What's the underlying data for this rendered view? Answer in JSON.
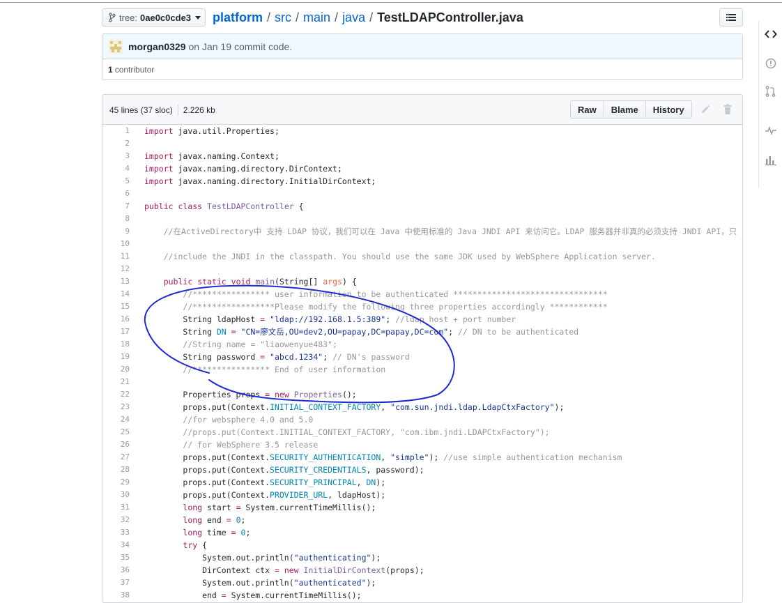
{
  "branch": {
    "prefix": "tree:",
    "name": "0ae0c0cde3"
  },
  "breadcrumb": {
    "repo": "platform",
    "segments": [
      "src",
      "main",
      "java"
    ],
    "separator": "/",
    "file": "TestLDAPController.java"
  },
  "commit": {
    "author": "morgan0329",
    "date": "on Jan 19",
    "message": "commit code.",
    "contributors_count": "1",
    "contributors_label": "contributor"
  },
  "file": {
    "lines_info": "45 lines (37 sloc)",
    "size": "2.226 kb",
    "buttons": {
      "raw": "Raw",
      "blame": "Blame",
      "history": "History"
    }
  },
  "code_lines": [
    {
      "n": "1",
      "t": [
        {
          "c": "kw",
          "v": "import"
        },
        {
          "c": "",
          "v": " java.util.Properties;"
        }
      ]
    },
    {
      "n": "2",
      "t": []
    },
    {
      "n": "3",
      "t": [
        {
          "c": "kw",
          "v": "import"
        },
        {
          "c": "",
          "v": " javax.naming.Context;"
        }
      ]
    },
    {
      "n": "4",
      "t": [
        {
          "c": "kw",
          "v": "import"
        },
        {
          "c": "",
          "v": " javax.naming.directory.DirContext;"
        }
      ]
    },
    {
      "n": "5",
      "t": [
        {
          "c": "kw",
          "v": "import"
        },
        {
          "c": "",
          "v": " javax.naming.directory.InitialDirContext;"
        }
      ]
    },
    {
      "n": "6",
      "t": []
    },
    {
      "n": "7",
      "t": [
        {
          "c": "kw",
          "v": "public"
        },
        {
          "c": "",
          "v": " "
        },
        {
          "c": "kw",
          "v": "class"
        },
        {
          "c": "",
          "v": " "
        },
        {
          "c": "en",
          "v": "TestLDAPController"
        },
        {
          "c": "",
          "v": " {"
        }
      ]
    },
    {
      "n": "8",
      "t": []
    },
    {
      "n": "9",
      "t": [
        {
          "c": "",
          "v": "    "
        },
        {
          "c": "c",
          "v": "//在ActiveDirectory中 支持 LDAP 协议，我们可以在 Java 中使用标准的 Java JNDI API 来访问它。LDAP 服务器并非真的必须支持 JNDI API，只要"
        }
      ]
    },
    {
      "n": "10",
      "t": []
    },
    {
      "n": "11",
      "t": [
        {
          "c": "",
          "v": "    "
        },
        {
          "c": "c",
          "v": "//include the JNDI in the classpath. You should use the same JDK used by WebSphere Application server."
        }
      ]
    },
    {
      "n": "12",
      "t": []
    },
    {
      "n": "13",
      "t": [
        {
          "c": "",
          "v": "    "
        },
        {
          "c": "kw",
          "v": "public"
        },
        {
          "c": "",
          "v": " "
        },
        {
          "c": "kw",
          "v": "static"
        },
        {
          "c": "",
          "v": " "
        },
        {
          "c": "kw",
          "v": "void"
        },
        {
          "c": "",
          "v": " "
        },
        {
          "c": "en",
          "v": "main"
        },
        {
          "c": "",
          "v": "(String[] "
        },
        {
          "c": "v",
          "v": "args"
        },
        {
          "c": "",
          "v": ") {"
        }
      ]
    },
    {
      "n": "14",
      "t": [
        {
          "c": "",
          "v": "        "
        },
        {
          "c": "c",
          "v": "//**************** user information to be authenticated ********************************"
        }
      ]
    },
    {
      "n": "15",
      "t": [
        {
          "c": "",
          "v": "        "
        },
        {
          "c": "c",
          "v": "//*****************Please modify the following three properties accordingly ************"
        }
      ]
    },
    {
      "n": "16",
      "t": [
        {
          "c": "",
          "v": "        String ldapHost "
        },
        {
          "c": "kw",
          "v": "="
        },
        {
          "c": "",
          "v": " "
        },
        {
          "c": "s",
          "v": "\"ldap://192.168.1.5:389\""
        },
        {
          "c": "",
          "v": "; "
        },
        {
          "c": "c",
          "v": "//ldap host + port number"
        }
      ]
    },
    {
      "n": "17",
      "t": [
        {
          "c": "",
          "v": "        String "
        },
        {
          "c": "cn",
          "v": "DN"
        },
        {
          "c": "",
          "v": " "
        },
        {
          "c": "kw",
          "v": "="
        },
        {
          "c": "",
          "v": " "
        },
        {
          "c": "s",
          "v": "\"CN=廖文岳,OU=dev2,OU=papay,DC=papay,DC=com\""
        },
        {
          "c": "",
          "v": "; "
        },
        {
          "c": "c",
          "v": "// DN to be authenticated"
        }
      ]
    },
    {
      "n": "18",
      "t": [
        {
          "c": "",
          "v": "        "
        },
        {
          "c": "c",
          "v": "//String name = \"liaowenyue483\";"
        }
      ]
    },
    {
      "n": "19",
      "t": [
        {
          "c": "",
          "v": "        String password "
        },
        {
          "c": "kw",
          "v": "="
        },
        {
          "c": "",
          "v": " "
        },
        {
          "c": "s",
          "v": "\"abcd.1234\""
        },
        {
          "c": "",
          "v": "; "
        },
        {
          "c": "c",
          "v": "// DN's password"
        }
      ]
    },
    {
      "n": "20",
      "t": [
        {
          "c": "",
          "v": "        "
        },
        {
          "c": "c",
          "v": "//**************** End of user information"
        }
      ]
    },
    {
      "n": "21",
      "t": []
    },
    {
      "n": "22",
      "t": [
        {
          "c": "",
          "v": "        Properties props "
        },
        {
          "c": "kw",
          "v": "="
        },
        {
          "c": "",
          "v": " "
        },
        {
          "c": "kw",
          "v": "new"
        },
        {
          "c": "",
          "v": " "
        },
        {
          "c": "en",
          "v": "Properties"
        },
        {
          "c": "",
          "v": "();"
        }
      ]
    },
    {
      "n": "23",
      "t": [
        {
          "c": "",
          "v": "        props.put(Context."
        },
        {
          "c": "cn",
          "v": "INITIAL_CONTEXT_FACTORY"
        },
        {
          "c": "",
          "v": ", "
        },
        {
          "c": "s",
          "v": "\"com.sun.jndi.ldap.LdapCtxFactory\""
        },
        {
          "c": "",
          "v": ");"
        }
      ]
    },
    {
      "n": "24",
      "t": [
        {
          "c": "",
          "v": "        "
        },
        {
          "c": "c",
          "v": "//for websphere 4.0 and 5.0"
        }
      ]
    },
    {
      "n": "25",
      "t": [
        {
          "c": "",
          "v": "        "
        },
        {
          "c": "c",
          "v": "//props.put(Context.INITIAL_CONTEXT_FACTORY, \"com.ibm.jndi.LDAPCtxFactory\");"
        }
      ]
    },
    {
      "n": "26",
      "t": [
        {
          "c": "",
          "v": "        "
        },
        {
          "c": "c",
          "v": "// for WebSphere 3.5 release"
        }
      ]
    },
    {
      "n": "27",
      "t": [
        {
          "c": "",
          "v": "        props.put(Context."
        },
        {
          "c": "cn",
          "v": "SECURITY_AUTHENTICATION"
        },
        {
          "c": "",
          "v": ", "
        },
        {
          "c": "s",
          "v": "\"simple\""
        },
        {
          "c": "",
          "v": "); "
        },
        {
          "c": "c",
          "v": "//use simple authentication mechanism"
        }
      ]
    },
    {
      "n": "28",
      "t": [
        {
          "c": "",
          "v": "        props.put(Context."
        },
        {
          "c": "cn",
          "v": "SECURITY_CREDENTIALS"
        },
        {
          "c": "",
          "v": ", password);"
        }
      ]
    },
    {
      "n": "29",
      "t": [
        {
          "c": "",
          "v": "        props.put(Context."
        },
        {
          "c": "cn",
          "v": "SECURITY_PRINCIPAL"
        },
        {
          "c": "",
          "v": ", "
        },
        {
          "c": "cn",
          "v": "DN"
        },
        {
          "c": "",
          "v": ");"
        }
      ]
    },
    {
      "n": "30",
      "t": [
        {
          "c": "",
          "v": "        props.put(Context."
        },
        {
          "c": "cn",
          "v": "PROVIDER_URL"
        },
        {
          "c": "",
          "v": ", ldapHost);"
        }
      ]
    },
    {
      "n": "31",
      "t": [
        {
          "c": "",
          "v": "        "
        },
        {
          "c": "kw",
          "v": "long"
        },
        {
          "c": "",
          "v": " start "
        },
        {
          "c": "kw",
          "v": "="
        },
        {
          "c": "",
          "v": " System.currentTimeMillis();"
        }
      ]
    },
    {
      "n": "32",
      "t": [
        {
          "c": "",
          "v": "        "
        },
        {
          "c": "kw",
          "v": "long"
        },
        {
          "c": "",
          "v": " end "
        },
        {
          "c": "kw",
          "v": "="
        },
        {
          "c": "",
          "v": " "
        },
        {
          "c": "cn",
          "v": "0"
        },
        {
          "c": "",
          "v": ";"
        }
      ]
    },
    {
      "n": "33",
      "t": [
        {
          "c": "",
          "v": "        "
        },
        {
          "c": "kw",
          "v": "long"
        },
        {
          "c": "",
          "v": " time "
        },
        {
          "c": "kw",
          "v": "="
        },
        {
          "c": "",
          "v": " "
        },
        {
          "c": "cn",
          "v": "0"
        },
        {
          "c": "",
          "v": ";"
        }
      ]
    },
    {
      "n": "34",
      "t": [
        {
          "c": "",
          "v": "        "
        },
        {
          "c": "kw",
          "v": "try"
        },
        {
          "c": "",
          "v": " {"
        }
      ]
    },
    {
      "n": "35",
      "t": [
        {
          "c": "",
          "v": "            System.out.println("
        },
        {
          "c": "s",
          "v": "\"authenticating\""
        },
        {
          "c": "",
          "v": ");"
        }
      ]
    },
    {
      "n": "36",
      "t": [
        {
          "c": "",
          "v": "            DirContext ctx "
        },
        {
          "c": "kw",
          "v": "="
        },
        {
          "c": "",
          "v": " "
        },
        {
          "c": "kw",
          "v": "new"
        },
        {
          "c": "",
          "v": " "
        },
        {
          "c": "en",
          "v": "InitialDirContext"
        },
        {
          "c": "",
          "v": "(props);"
        }
      ]
    },
    {
      "n": "37",
      "t": [
        {
          "c": "",
          "v": "            System.out.println("
        },
        {
          "c": "s",
          "v": "\"authenticated\""
        },
        {
          "c": "",
          "v": ");"
        }
      ]
    },
    {
      "n": "38",
      "t": [
        {
          "c": "",
          "v": "            end "
        },
        {
          "c": "kw",
          "v": "="
        },
        {
          "c": "",
          "v": " System.currentTimeMillis();"
        }
      ]
    }
  ],
  "icons": {
    "branch": "branch-icon",
    "toc": "list-icon",
    "edit": "pencil-icon",
    "delete": "trash-icon",
    "rail": [
      "code-icon",
      "issue-icon",
      "pull-request-icon",
      "pulse-icon",
      "graph-icon"
    ]
  },
  "colors": {
    "link": "#0366d6",
    "keyword": "#a71d5d",
    "entity": "#795da3",
    "comment": "#969896",
    "string": "#183691",
    "constant": "#0086b3",
    "annotation": "#1f2bd1"
  }
}
